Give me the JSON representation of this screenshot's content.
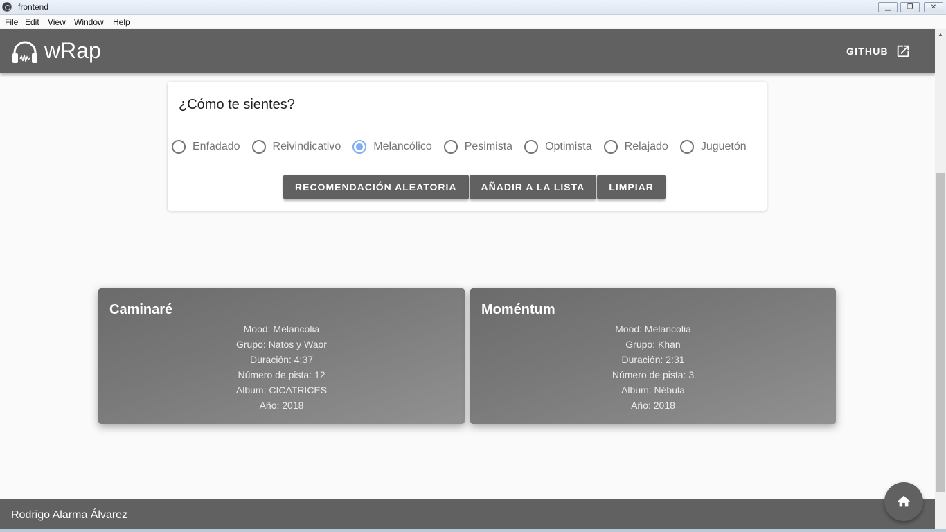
{
  "window": {
    "title": "frontend"
  },
  "menu": [
    "File",
    "Edit",
    "View",
    "Window",
    "Help"
  ],
  "header": {
    "brand": "wRap",
    "github_label": "GITHUB"
  },
  "mood_panel": {
    "question": "¿Cómo te sientes?",
    "options": [
      "Enfadado",
      "Reivindicativo",
      "Melancólico",
      "Pesimista",
      "Optimista",
      "Relajado",
      "Juguetón"
    ],
    "selected": "Melancólico",
    "buttons": {
      "random": "RECOMENDACIÓN ALEATORIA",
      "add": "AÑADIR A LA LISTA",
      "clear": "LIMPIAR"
    }
  },
  "songs": [
    {
      "title": "Caminaré",
      "lines": [
        "Mood: Melancolia",
        "Grupo: Natos y Waor",
        "Duración: 4:37",
        "Número de pista: 12",
        "Album: CICATRICES",
        "Año: 2018"
      ]
    },
    {
      "title": "Moméntum",
      "lines": [
        "Mood: Melancolia",
        "Grupo: Khan",
        "Duración: 2:31",
        "Número de pista: 3",
        "Album: Nébula",
        "Año: 2018"
      ]
    }
  ],
  "footer": {
    "author": "Rodrigo Alarma Álvarez"
  },
  "colors": {
    "primary": "#616161",
    "radio_accent": "#82aef2",
    "background": "#fafafa"
  }
}
